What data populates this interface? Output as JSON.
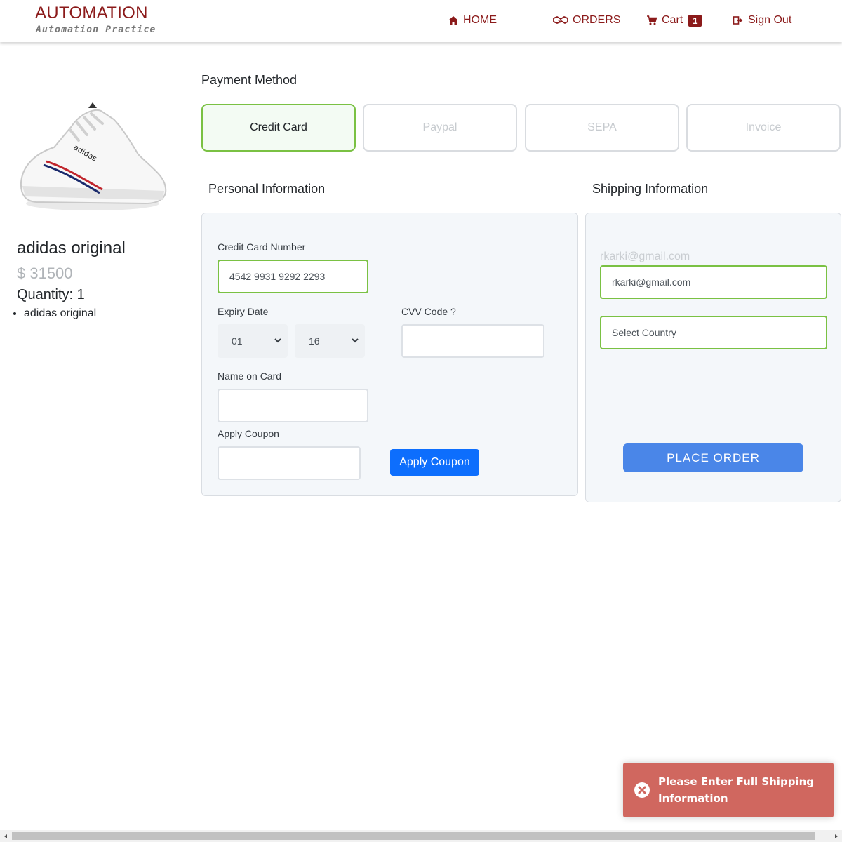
{
  "header": {
    "logo_title": "AUTOMATION",
    "logo_subtitle": "Automation Practice",
    "nav": {
      "home": "HOME",
      "orders": "ORDERS",
      "cart": "Cart",
      "cart_count": "1",
      "sign_out": "Sign Out"
    },
    "colors": {
      "brand": "#8b1a1a"
    }
  },
  "product": {
    "image_icon": "sneaker-image",
    "name": "adidas original",
    "price": "$ 31500",
    "quantity": "Quantity: 1",
    "items": [
      "adidas original"
    ]
  },
  "payment": {
    "title": "Payment Method",
    "options": [
      "Credit Card",
      "Paypal",
      "SEPA",
      "Invoice"
    ],
    "selected": "Credit Card"
  },
  "personal": {
    "title": "Personal Information",
    "card_number_label": "Credit Card Number",
    "card_number_value": "4542 9931 9292 2293",
    "expiry_label": "Expiry Date",
    "expiry_month": "01",
    "expiry_year": "16",
    "cvv_label": "CVV Code ?",
    "cvv_value": "",
    "name_label": "Name on Card",
    "name_value": "",
    "coupon_label": "Apply Coupon",
    "coupon_value": "",
    "coupon_button": "Apply Coupon"
  },
  "shipping": {
    "title": "Shipping Information",
    "email_hint": "rkarki@gmail.com",
    "email_value": "rkarki@gmail.com",
    "country_value": "Select Country",
    "place_order": "PLACE ORDER"
  },
  "toast": {
    "message": "Please Enter Full Shipping Information",
    "icon": "error-x-icon",
    "color": "#d0675f"
  }
}
